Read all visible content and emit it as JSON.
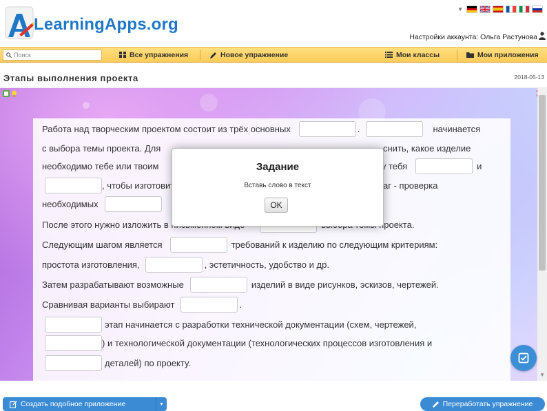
{
  "header": {
    "logo_text": "LearningApps.org",
    "account_label": "Настройки аккаунта: Ольга Растунова",
    "flags": [
      "de",
      "gb",
      "es",
      "fr",
      "it",
      "ru"
    ]
  },
  "navbar": {
    "search_placeholder": "Поиск",
    "all_exercises": "Все упражнения",
    "new_exercise": "Новое упражнение",
    "my_classes": "Мои классы",
    "my_apps": "Мои приложения"
  },
  "page": {
    "title": "Этапы выполнения проекта",
    "date": "2018-05-13"
  },
  "exercise": {
    "lines": [
      [
        "Работа над творческим проектом состоит из трёх основных",
        "#",
        ".",
        "#",
        "начинается"
      ],
      [
        "с выбора темы проекта. Для",
        "",
        "",
        "снить, какое изделие"
      ],
      [
        "необходимо тебе или твоим",
        "",
        "",
        "и у тебя",
        "#",
        "и"
      ],
      [
        "#",
        ", чтобы изготовить",
        "",
        "",
        "аг - проверка"
      ],
      [
        "необходимых",
        "#"
      ],
      [
        "После этого нужно изложить в письменном виде",
        "#",
        "выбора темы проекта."
      ],
      [
        "Следующим шагом является",
        "#",
        "требований к изделию по следующим критериям:"
      ],
      [
        "простота изготовления,",
        "#",
        ", эстетичность, удобство и др."
      ],
      [
        "Затем разрабатывают возможные",
        "#",
        "изделий в виде рисунков, эскизов, чертежей."
      ],
      [
        "Сравнивая варианты выбирают",
        "#",
        "."
      ],
      [
        "#",
        "этап начинается с разработки технической документации (схем, чертежей,"
      ],
      [
        "#",
        ") и технологической документации (технологических процессов изготовления и"
      ],
      [
        "#",
        "деталей) по проекту."
      ]
    ]
  },
  "dialog": {
    "title": "Задание",
    "text": "Вставь слово в текст",
    "ok_label": "OK"
  },
  "footer": {
    "create_similar": "Создать подобное приложение",
    "rework": "Переработать упражнение"
  },
  "colors": {
    "brand_blue": "#1f77c6",
    "nav_yellow": "#fbcc5a",
    "button_blue": "#3a8bd4"
  }
}
